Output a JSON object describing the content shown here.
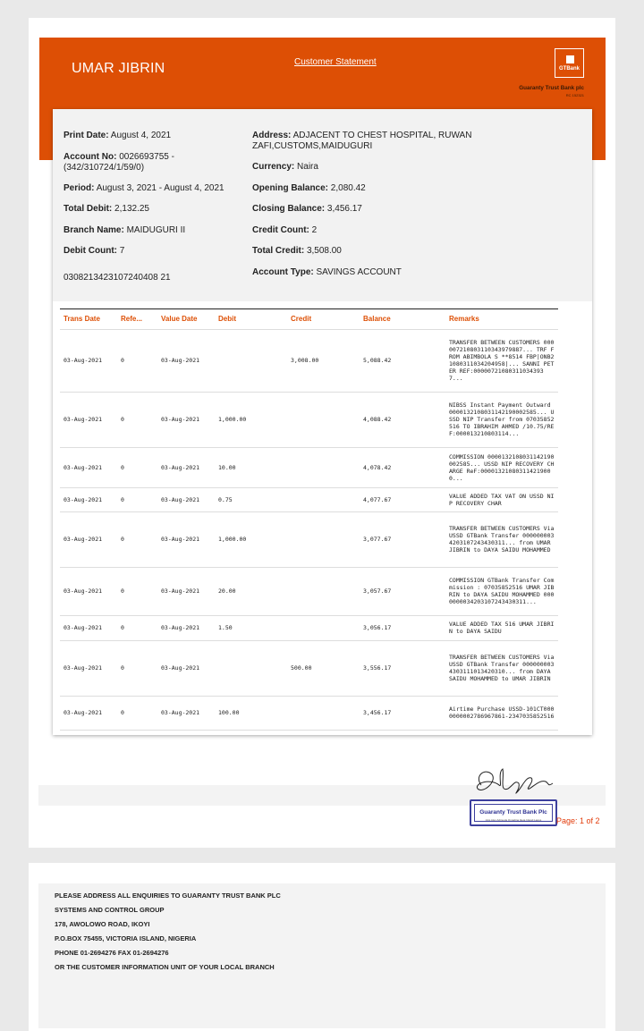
{
  "header": {
    "account_name": "UMAR JIBRIN",
    "statement_link": "Customer Statement",
    "logo_text": "GTBank",
    "bank_name": "Guaranty Trust Bank plc",
    "bank_sub": "RC 152321"
  },
  "info": {
    "print_date_label": "Print Date:",
    "print_date": "August 4, 2021",
    "account_no_label": "Account No:",
    "account_no": "0026693755 - (342/310724/1/59/0)",
    "period_label": "Period:",
    "period": "August 3, 2021 - August 4, 2021",
    "total_debit_label": "Total Debit:",
    "total_debit": "2,132.25",
    "branch_name_label": "Branch Name:",
    "branch_name": "MAIDUGURI II",
    "debit_count_label": "Debit Count:",
    "debit_count": "7",
    "reference": "0308213423107240408 21",
    "address_label": "Address:",
    "address": "ADJACENT TO CHEST HOSPITAL, RUWAN ZAFI,CUSTOMS,MAIDUGURI",
    "currency_label": "Currency:",
    "currency": "Naira",
    "opening_balance_label": "Opening Balance:",
    "opening_balance": "2,080.42",
    "closing_balance_label": "Closing Balance:",
    "closing_balance": "3,456.17",
    "credit_count_label": "Credit Count:",
    "credit_count": "2",
    "total_credit_label": "Total Credit:",
    "total_credit": "3,508.00",
    "account_type_label": "Account Type:",
    "account_type": "SAVINGS ACCOUNT"
  },
  "table": {
    "columns": [
      "Trans Date",
      "Refe...",
      "Value Date",
      "Debit",
      "Credit",
      "Balance",
      "Remarks"
    ],
    "rows": [
      {
        "trans_date": "03-Aug-2021",
        "ref": "0",
        "value_date": "03-Aug-2021",
        "debit": "",
        "credit": "3,008.00",
        "balance": "5,088.42",
        "remarks": "TRANSFER BETWEEN CUSTOMERS 000007210803110343979887... TRF FROM ABIMBOLA S **8514 FBP|ONB210803110342049​58|... SANNI PETER REF:000007210803110343937..."
      },
      {
        "trans_date": "03-Aug-2021",
        "ref": "0",
        "value_date": "03-Aug-2021",
        "debit": "1,000.00",
        "credit": "",
        "balance": "4,088.42",
        "remarks": "NIBSS Instant Payment Outward 000013210803114219000258​5... USSD NIP Transfer from 07035852516 TO IBRAHIM AHMED /10.75/REF:000013210803114..."
      },
      {
        "trans_date": "03-Aug-2021",
        "ref": "0",
        "value_date": "03-Aug-2021",
        "debit": "10.00",
        "credit": "",
        "balance": "4,078.42",
        "remarks": "COMMISSION 000013210803114219000258​5... USSD NIP RECOVERY CHARGE ReF:000013210803114219000..."
      },
      {
        "trans_date": "03-Aug-2021",
        "ref": "0",
        "value_date": "03-Aug-2021",
        "debit": "0.75",
        "credit": "",
        "balance": "4,077.67",
        "remarks": "VALUE ADDED TAX VAT ON USSD NIP RECOVERY CHAR"
      },
      {
        "trans_date": "03-Aug-2021",
        "ref": "0",
        "value_date": "03-Aug-2021",
        "debit": "1,000.00",
        "credit": "",
        "balance": "3,077.67",
        "remarks": "TRANSFER BETWEEN CUSTOMERS Via USSD GTBank Transfer 00000000342031072434303​11... from UMAR JIBRIN to DAYA SAIDU MOHAMMED"
      },
      {
        "trans_date": "03-Aug-2021",
        "ref": "0",
        "value_date": "03-Aug-2021",
        "debit": "20.00",
        "credit": "",
        "balance": "3,057.67",
        "remarks": "COMMISSION GTBank Transfer Commission : 07035852516 UMAR JIBRIN to DAYA SAIDU MOHAMMED 00000000342031072434303​11..."
      },
      {
        "trans_date": "03-Aug-2021",
        "ref": "0",
        "value_date": "03-Aug-2021",
        "debit": "1.50",
        "credit": "",
        "balance": "3,056.17",
        "remarks": "VALUE ADDED TAX 516 UMAR JIBRIN to DAYA SAIDU"
      },
      {
        "trans_date": "03-Aug-2021",
        "ref": "0",
        "value_date": "03-Aug-2021",
        "debit": "",
        "credit": "500.00",
        "balance": "3,556.17",
        "remarks": "TRANSFER BETWEEN CUSTOMERS Via USSD GTBank Transfer 00000000343031110134203​10... from DAYA SAIDU MOHAMMED to UMAR JIBRIN"
      },
      {
        "trans_date": "03-Aug-2021",
        "ref": "0",
        "value_date": "03-Aug-2021",
        "debit": "100.00",
        "credit": "",
        "balance": "3,456.17",
        "remarks": "Airtime Purchase USSD-101CT000000000278696786​1-2347035852516"
      }
    ]
  },
  "footer": {
    "stamp_text": "Guaranty Trust Bank Plc",
    "stamp_sub": "AAL Alex Adinuola Omadina Ikeja Inland Lagos",
    "page_label": "Page: 1 of 2"
  },
  "enquiries": {
    "lines": [
      "PLEASE ADDRESS ALL ENQUIRIES TO GUARANTY TRUST BANK PLC",
      "SYSTEMS AND CONTROL GROUP",
      "178, AWOLOWO ROAD, IKOYI",
      "P.O.BOX 75455, VICTORIA ISLAND, NIGERIA",
      "PHONE 01-2694276 FAX 01-2694276",
      "OR THE CUSTOMER INFORMATION UNIT OF YOUR LOCAL BRANCH"
    ]
  },
  "colors": {
    "brand": "#dd4f05",
    "stamp": "#3c3f9e",
    "page_number": "#e23b0a"
  }
}
